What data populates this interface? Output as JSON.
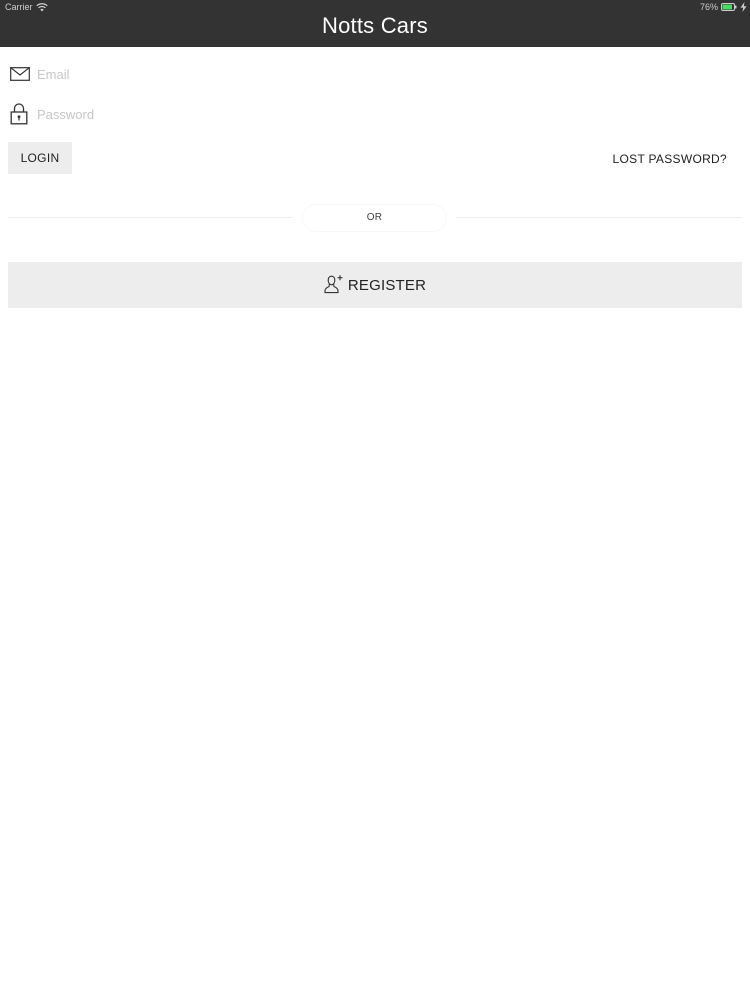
{
  "status_bar": {
    "carrier": "Carrier",
    "battery_percent": "76%"
  },
  "header": {
    "title": "Notts Cars"
  },
  "login_form": {
    "email": {
      "value": "",
      "placeholder": "Email",
      "icon": "envelope-icon"
    },
    "password": {
      "value": "",
      "placeholder": "Password",
      "icon": "lock-icon"
    },
    "login_label": "LOGIN",
    "lost_password_label": "LOST PASSWORD?"
  },
  "separator": {
    "label": "OR"
  },
  "register": {
    "label": "REGISTER",
    "icon": "add-user-icon"
  },
  "colors": {
    "header_bg": "#333333",
    "button_bg": "#EDEDEE",
    "battery": "#4CD964"
  }
}
